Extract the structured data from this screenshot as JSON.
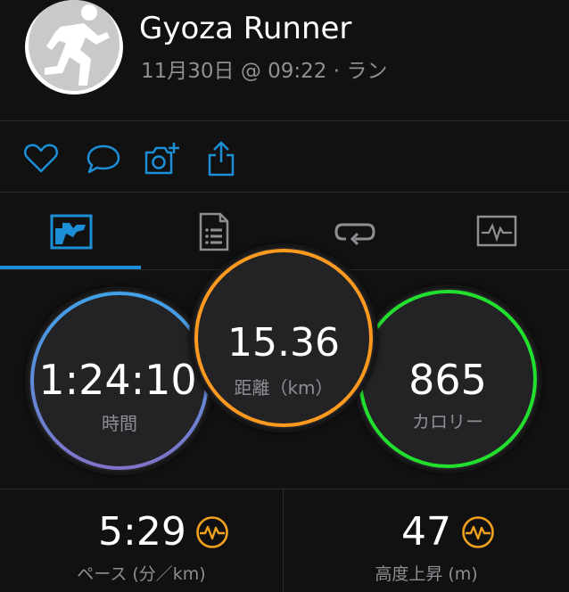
{
  "header": {
    "title": "Gyoza Runner",
    "subtitle": "11月30日 @ 09:22 · ラン"
  },
  "actions": [
    {
      "icon": "heart-icon"
    },
    {
      "icon": "comment-icon"
    },
    {
      "icon": "add-photo-icon"
    },
    {
      "icon": "share-icon"
    }
  ],
  "tabs": [
    {
      "icon": "overview-chart-icon",
      "selected": true
    },
    {
      "icon": "details-list-icon",
      "selected": false
    },
    {
      "icon": "laps-icon",
      "selected": false
    },
    {
      "icon": "graph-icon",
      "selected": false
    }
  ],
  "summary": {
    "time": {
      "value": "1:24:10",
      "label": "時間",
      "color": "#3fa2e8"
    },
    "distance": {
      "value": "15.36",
      "label": "距離（km）",
      "color": "#ff9a1f"
    },
    "calories": {
      "value": "865",
      "label": "カロリー",
      "color": "#22e02e"
    }
  },
  "stats": {
    "pace": {
      "value": "5:29",
      "label": "ペース (分／km)"
    },
    "elevation": {
      "value": "47",
      "label": "高度上昇 (m)"
    }
  },
  "colors": {
    "accent": "#1d8fd6",
    "background": "#111112",
    "time_ring_bottom": "#7f74c9",
    "metric_badge": "#f2a11f"
  }
}
